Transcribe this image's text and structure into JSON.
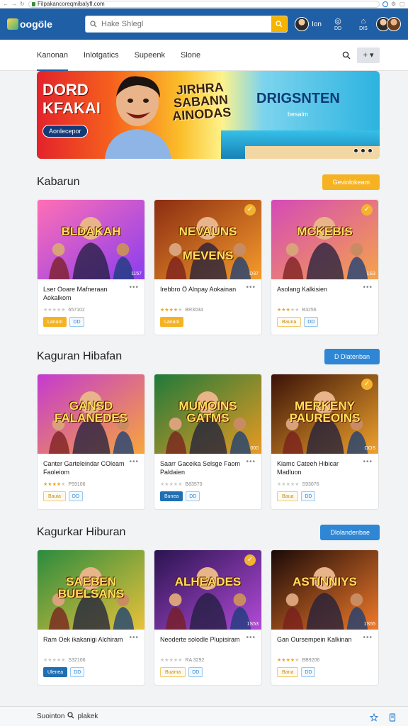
{
  "browser": {
    "url": "Filpakancoreqmibalyfl.com"
  },
  "header": {
    "logo": "oogöle",
    "search_placeholder": "Hake Shlegl",
    "user_label": "Ion",
    "icons": [
      {
        "name": "chat-icon",
        "label": "DD"
      },
      {
        "name": "bell-icon",
        "label": "DIS"
      }
    ]
  },
  "tabs": [
    {
      "label": "Kanonan",
      "active": true
    },
    {
      "label": "Inlotgatics",
      "active": false
    },
    {
      "label": "Supeenk",
      "active": false
    },
    {
      "label": "Slone",
      "active": false
    }
  ],
  "tab_menu_label": "+ ▾",
  "hero": {
    "left_title": "DORD\nKFAKAI",
    "left_cta": "Aonlecepor",
    "center_title": "JIRHRA\nSABANN\nAINODAS",
    "right_title": "DRIGSNTEN",
    "right_sub": "besalm"
  },
  "sections": [
    {
      "title": "Kabarun",
      "button": "Geviolokeam",
      "button_color": "orange",
      "cards": [
        {
          "art_title": "BLDAKAH",
          "name": "Lser Ooare Mafneraan Aokalkom",
          "rating": 0,
          "count": "657102",
          "badge": "1157",
          "check": false,
          "primary": "Lanam",
          "primary_style": "filled-orange",
          "tag": "DD"
        },
        {
          "art_title": "NEVAUNS\n\nMEVENS",
          "name": "Irebbro Ö Alnpay Aokainan",
          "rating": 4,
          "count": "BR3034",
          "badge": "D37",
          "check": true,
          "primary": "Lanam",
          "primary_style": "filled-orange",
          "tag": ""
        },
        {
          "art_title": "MCKEBIS",
          "name": "Asolang Kalkisien",
          "rating": 3,
          "count": "B3256",
          "badge": "1S3",
          "check": true,
          "primary": "Bauna",
          "primary_style": "outline",
          "tag": "DD"
        }
      ]
    },
    {
      "title": "Kaguran Hibafan",
      "button": "D Dlatenban",
      "button_color": "blue",
      "cards": [
        {
          "art_title": "GANSD\nFALANEDES",
          "name": "Canter Garteleindar COleam Faoleiom",
          "rating": 4,
          "count": "P59106",
          "badge": "",
          "check": false,
          "primary": "Bauia",
          "primary_style": "outline",
          "tag": "DD"
        },
        {
          "art_title": "MUMOINS\nGATMS",
          "name": "Saarr Gaceika Selsge Faom Paldaien",
          "rating": 0,
          "count": "B83570",
          "badge": "000",
          "check": false,
          "primary": "Bunea",
          "primary_style": "filled-blue",
          "tag": "DD"
        },
        {
          "art_title": "MERKENY\nPAUREOINS",
          "name": "Kiamc Cateeh Hibicar Madluon",
          "rating": 0,
          "count": "S93076",
          "badge": "OOS",
          "check": true,
          "primary": "Baua",
          "primary_style": "outline",
          "tag": "DD"
        }
      ]
    },
    {
      "title": "Kagurkar Hiburan",
      "button": "Dlolandenbae",
      "button_color": "blue",
      "cards": [
        {
          "art_title": "SAEBEN\nBUELSANS",
          "name": "Ram Oek ikakanigi Alchiram",
          "rating": 0,
          "count": "S32106",
          "badge": "",
          "check": false,
          "primary": "Ulenea",
          "primary_style": "filled-blue",
          "tag": "DD"
        },
        {
          "art_title": "ALHEADES",
          "name": "Neoderte solodle Plupisiram",
          "rating": 0,
          "count": "RA 3292",
          "badge": "1S53",
          "check": true,
          "primary": "Buama",
          "primary_style": "outline",
          "tag": "DD"
        },
        {
          "art_title": "ASTINNIYS",
          "name": "Gan Oursempein Kalkinan",
          "rating": 4,
          "count": "BB9206",
          "badge": "1S55",
          "check": false,
          "primary": "Bana",
          "primary_style": "outline",
          "tag": "DD"
        }
      ]
    }
  ],
  "footer": {
    "label": "Suointon",
    "search_label": "plakek"
  },
  "colors": {
    "brand": "#1f5fa6",
    "accent_orange": "#f5b324",
    "accent_blue": "#2e86d4"
  }
}
